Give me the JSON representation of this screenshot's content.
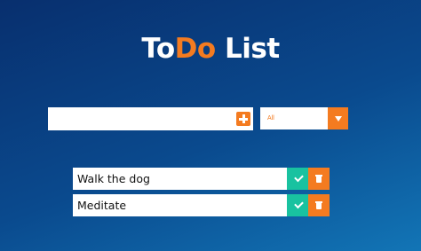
{
  "header": {
    "title_part1": "To",
    "title_part2": "Do",
    "title_part3": " List"
  },
  "form": {
    "input_value": "",
    "add_icon": "plus-square-icon",
    "filter_selected": "All",
    "filter_icon": "caret-down-icon"
  },
  "todos": [
    {
      "text": "Walk the dog"
    },
    {
      "text": "Meditate"
    }
  ],
  "icons": {
    "complete": "check-icon",
    "delete": "trash-icon"
  },
  "colors": {
    "accent": "#f47b20",
    "complete": "#19c2a0",
    "background_top": "#082f6e",
    "background_bottom": "#1275b6"
  }
}
